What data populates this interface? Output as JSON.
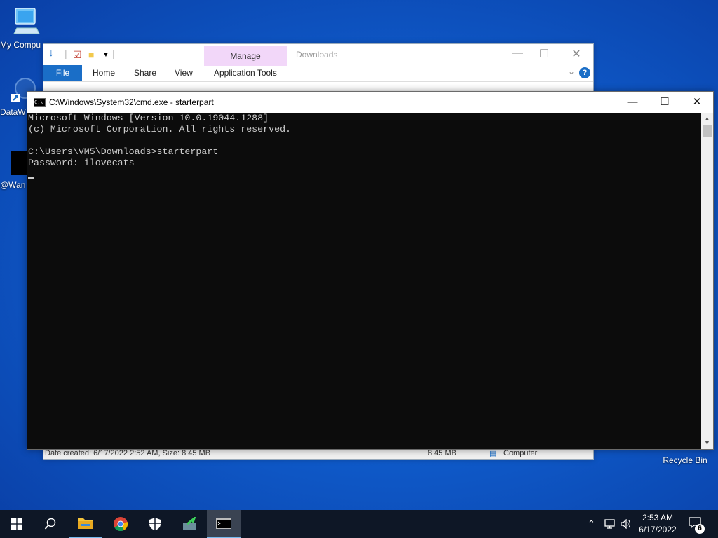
{
  "desktop": {
    "icons": [
      {
        "label": "My Compu"
      },
      {
        "label": "DataW"
      },
      {
        "label": "@Wan"
      },
      {
        "label": "Recycle Bin"
      }
    ]
  },
  "explorer": {
    "title": "Downloads",
    "manage_tab": "Manage",
    "ribbon_tabs": [
      "File",
      "Home",
      "Share",
      "View",
      "Application Tools"
    ],
    "status": {
      "left": "Date created: 6/17/2022 2:52 AM, Size: 8.45 MB",
      "size": "8.45 MB",
      "location": "Computer"
    }
  },
  "cmd": {
    "title": "C:\\Windows\\System32\\cmd.exe - starterpart",
    "lines": [
      "Microsoft Windows [Version 10.0.19044.1288]",
      "(c) Microsoft Corporation. All rights reserved.",
      "",
      "C:\\Users\\VM5\\Downloads>starterpart",
      "Password: ilovecats"
    ]
  },
  "taskbar": {
    "clock_time": "2:53 AM",
    "clock_date": "6/17/2022",
    "notification_count": "6"
  },
  "colors": {
    "accent": "#1a6ec7",
    "taskbar": "#0e1726",
    "console_bg": "#0c0c0c",
    "console_fg": "#cccccc"
  }
}
